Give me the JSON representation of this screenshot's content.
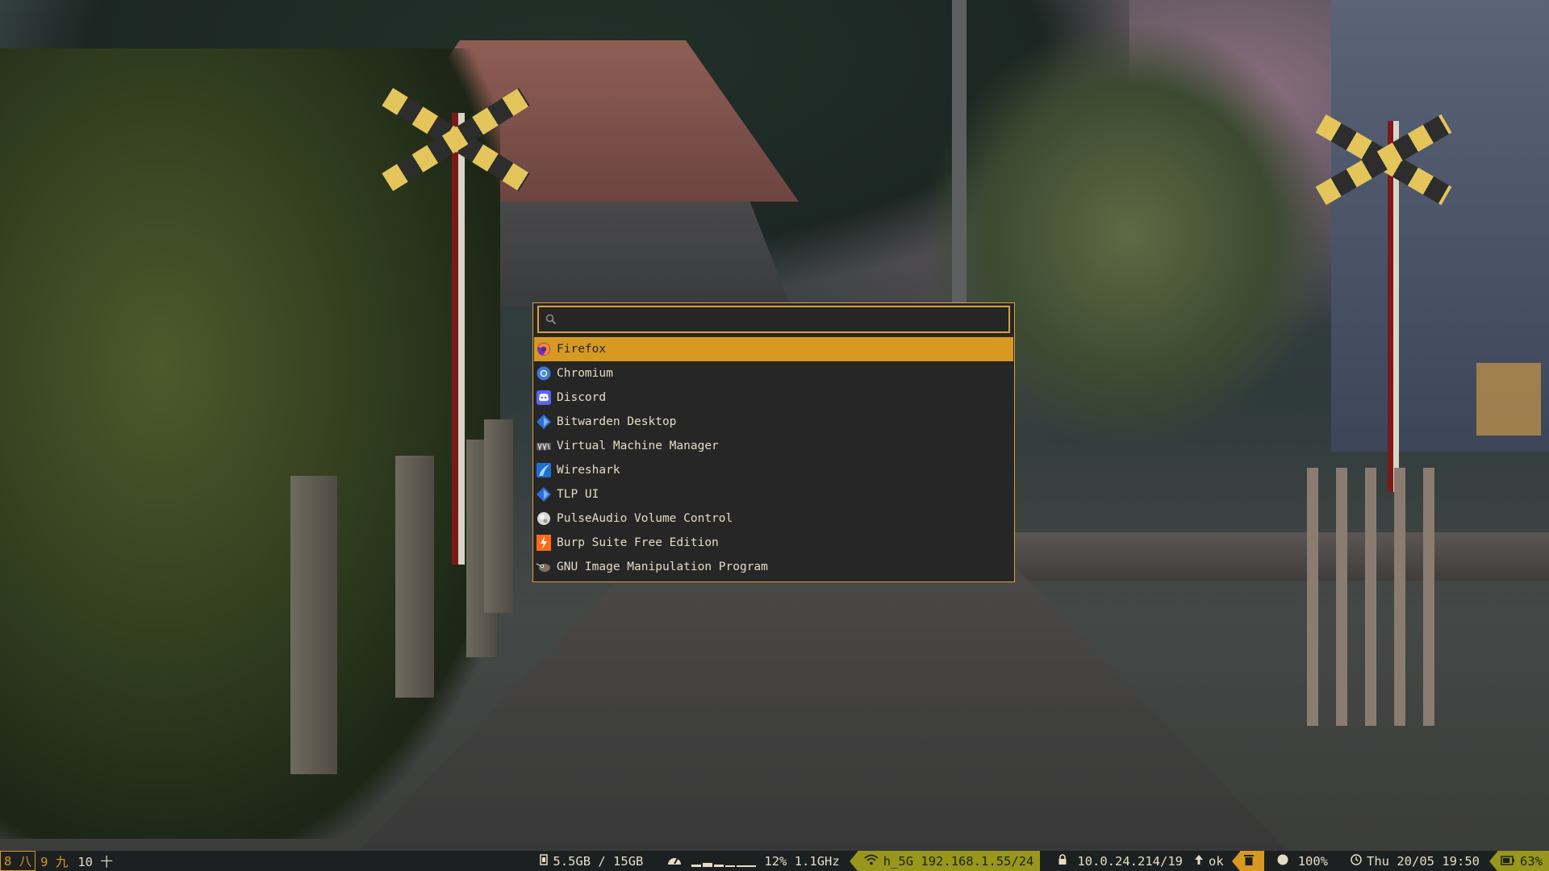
{
  "launcher": {
    "search_value": "",
    "items": [
      {
        "label": "Firefox",
        "icon": "firefox-icon",
        "selected": true
      },
      {
        "label": "Chromium",
        "icon": "chromium-icon"
      },
      {
        "label": "Discord",
        "icon": "discord-icon"
      },
      {
        "label": "Bitwarden Desktop",
        "icon": "bitwarden-icon"
      },
      {
        "label": "Virtual Machine Manager",
        "icon": "virt-manager-icon"
      },
      {
        "label": "Wireshark",
        "icon": "wireshark-icon"
      },
      {
        "label": "TLP UI",
        "icon": "tlp-icon"
      },
      {
        "label": "PulseAudio Volume Control",
        "icon": "pavucontrol-icon"
      },
      {
        "label": "Burp Suite Free Edition",
        "icon": "burp-icon"
      },
      {
        "label": "GNU Image Manipulation Program",
        "icon": "gimp-icon"
      }
    ]
  },
  "statusbar": {
    "workspaces": [
      {
        "label": "8 八",
        "active": true
      },
      {
        "label": "9 九",
        "active": false
      },
      {
        "label": "10 十",
        "active": false
      }
    ],
    "memory": "5.5GB / 15GB",
    "cpu": "12% 1.1GHz",
    "wifi": "h_5G 192.168.1.55/24",
    "vpn": "10.0.24.214/19",
    "updates": "ok",
    "brightness": "100%",
    "datetime": "Thu 20/05 19:50",
    "battery": "63%",
    "colors": {
      "accent": "#d79922",
      "bar_bg": "#1d2021",
      "green": "#98971a",
      "fg": "#e6dcc2"
    }
  }
}
